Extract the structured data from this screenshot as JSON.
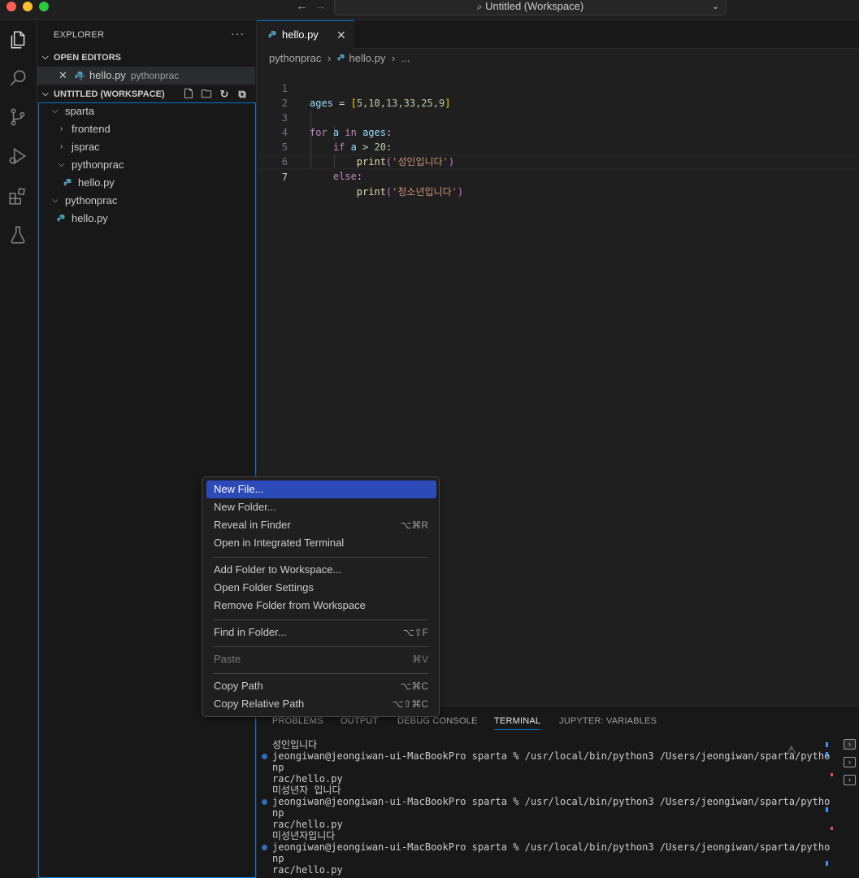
{
  "window": {
    "title": "Untitled (Workspace)"
  },
  "sidebar": {
    "header": "EXPLORER",
    "more": "···",
    "open_editors": {
      "title": "OPEN EDITORS",
      "items": [
        {
          "name": "hello.py",
          "folder": "pythonprac"
        }
      ]
    },
    "workspace": {
      "title": "UNTITLED (WORKSPACE)",
      "tree": [
        {
          "label": "sparta",
          "type": "folder",
          "expanded": true
        },
        {
          "label": "frontend",
          "type": "folder",
          "expanded": false
        },
        {
          "label": "jsprac",
          "type": "folder",
          "expanded": false
        },
        {
          "label": "pythonprac",
          "type": "folder",
          "expanded": true
        },
        {
          "label": "hello.py",
          "type": "file"
        },
        {
          "label": "pythonprac",
          "type": "folder",
          "expanded": true
        },
        {
          "label": "hello.py",
          "type": "file"
        }
      ]
    }
  },
  "editor": {
    "tab": {
      "label": "hello.py"
    },
    "breadcrumb": {
      "folder": "pythonprac",
      "file": "hello.py",
      "more": "..."
    },
    "lines": [
      {
        "n": "1"
      },
      {
        "n": "2"
      },
      {
        "n": "3"
      },
      {
        "n": "4"
      },
      {
        "n": "5"
      },
      {
        "n": "6"
      },
      {
        "n": "7"
      }
    ],
    "code": {
      "l1_var": "ages",
      "l1_eq": " = ",
      "l1_list": "5,10,13,33,25,9",
      "l3_for": "for",
      "l3_a": "a",
      "l3_in": "in",
      "l3_ages": "ages",
      "l4_if": "if",
      "l4_a": "a",
      "l4_op": " > ",
      "l4_num": "20",
      "l5_print": "print",
      "l5_str": "'성인입니다'",
      "l6_else": "else",
      "l7_print": "print",
      "l7_str": "'청소년입니다'"
    }
  },
  "panel": {
    "tabs": [
      "PROBLEMS",
      "OUTPUT",
      "DEBUG CONSOLE",
      "TERMINAL",
      "JUPYTER: VARIABLES"
    ],
    "active_tab": "TERMINAL",
    "terminal_lines": [
      "성인입니다",
      "jeongiwan@jeongiwan-ui-MacBookPro sparta % /usr/local/bin/python3 /Users/jeongiwan/sparta/pytho",
      "np",
      "rac/hello.py",
      "미성년자 입니다",
      "jeongiwan@jeongiwan-ui-MacBookPro sparta % /usr/local/bin/python3 /Users/jeongiwan/sparta/pytho",
      "np",
      "rac/hello.py",
      "미성년자입니다",
      "jeongiwan@jeongiwan-ui-MacBookPro sparta % /usr/local/bin/python3 /Users/jeongiwan/sparta/pytho",
      "np",
      "rac/hello.py"
    ]
  },
  "context_menu": {
    "items": [
      {
        "label": "New File...",
        "shortcut": ""
      },
      {
        "label": "New Folder...",
        "shortcut": ""
      },
      {
        "label": "Reveal in Finder",
        "shortcut": "⌥⌘R"
      },
      {
        "label": "Open in Integrated Terminal",
        "shortcut": ""
      },
      {
        "label": "Add Folder to Workspace...",
        "shortcut": ""
      },
      {
        "label": "Open Folder Settings",
        "shortcut": ""
      },
      {
        "label": "Remove Folder from Workspace",
        "shortcut": ""
      },
      {
        "label": "Find in Folder...",
        "shortcut": "⌥⇧F"
      },
      {
        "label": "Paste",
        "shortcut": "⌘V"
      },
      {
        "label": "Copy Path",
        "shortcut": "⌥⌘C"
      },
      {
        "label": "Copy Relative Path",
        "shortcut": "⌥⇧⌘C"
      }
    ]
  },
  "colors": {
    "accent": "#0078d4",
    "menu_selection": "#2c4bb8",
    "python_icon": "#519aba"
  }
}
